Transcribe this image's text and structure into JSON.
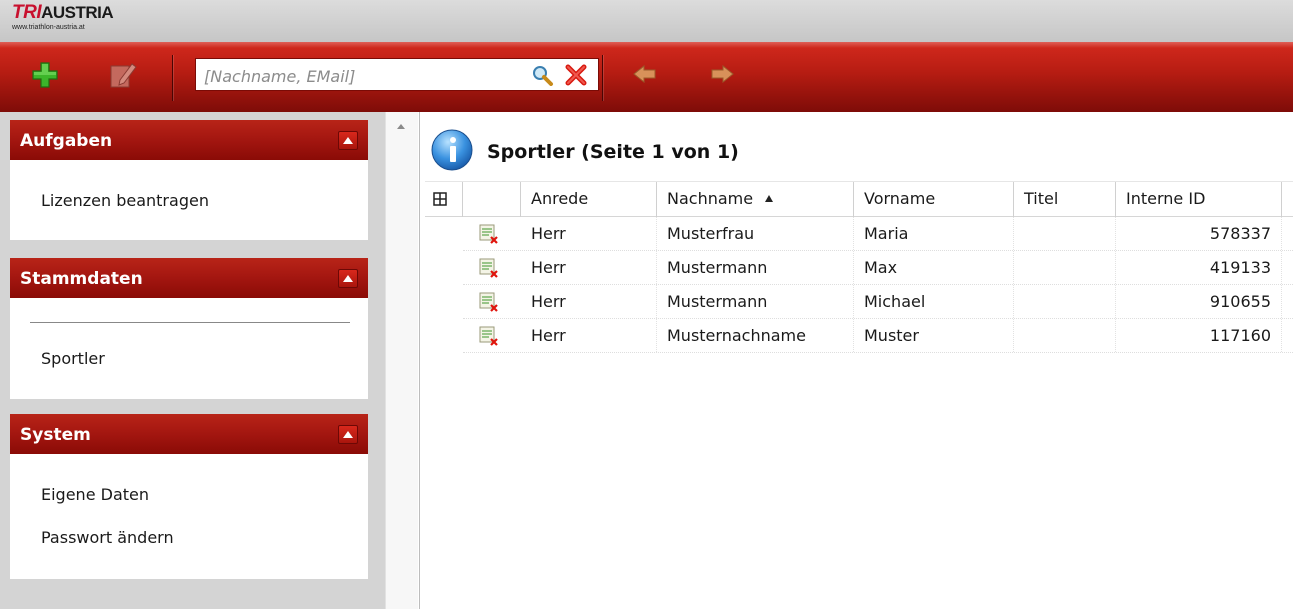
{
  "brand": {
    "tri": "TRI",
    "austria": "AUSTRIA",
    "url": "www.triathlon-austria.at"
  },
  "toolbar": {
    "search_placeholder": "[Nachname, EMail]",
    "search_value": ""
  },
  "sidebar": {
    "panels": [
      {
        "title": "Aufgaben",
        "items": [
          "Lizenzen beantragen"
        ]
      },
      {
        "title": "Stammdaten",
        "items": [
          "Sportler"
        ]
      },
      {
        "title": "System",
        "items": [
          "Eigene Daten",
          "Passwort ändern"
        ]
      }
    ]
  },
  "main": {
    "title": "Sportler (Seite 1 von 1)",
    "columns": [
      "Anrede",
      "Nachname",
      "Vorname",
      "Titel",
      "Interne ID"
    ],
    "sort_column": "Nachname",
    "sort_direction": "ascending",
    "rows": [
      {
        "anrede": "Herr",
        "nachname": "Musterfrau",
        "vorname": "Maria",
        "titel": "",
        "id": "578337"
      },
      {
        "anrede": "Herr",
        "nachname": "Mustermann",
        "vorname": "Max",
        "titel": "",
        "id": "419133"
      },
      {
        "anrede": "Herr",
        "nachname": "Mustermann",
        "vorname": "Michael",
        "titel": "",
        "id": "910655"
      },
      {
        "anrede": "Herr",
        "nachname": "Musternachname",
        "vorname": "Muster",
        "titel": "",
        "id": "117160"
      }
    ]
  },
  "colors": {
    "brand_red": "#c8102e",
    "toolbar_red": "#b51c12",
    "panel_header_red": "#a31610",
    "sidebar_bg": "#d4d4d4"
  },
  "icons": {
    "add": "plus-icon",
    "edit": "edit-icon",
    "search": "magnifier-icon",
    "clear": "clear-x-icon",
    "back": "arrow-left-icon",
    "forward": "arrow-right-icon",
    "info": "info-icon",
    "delete_row": "delete-record-icon",
    "column_chooser": "grid-icon"
  }
}
